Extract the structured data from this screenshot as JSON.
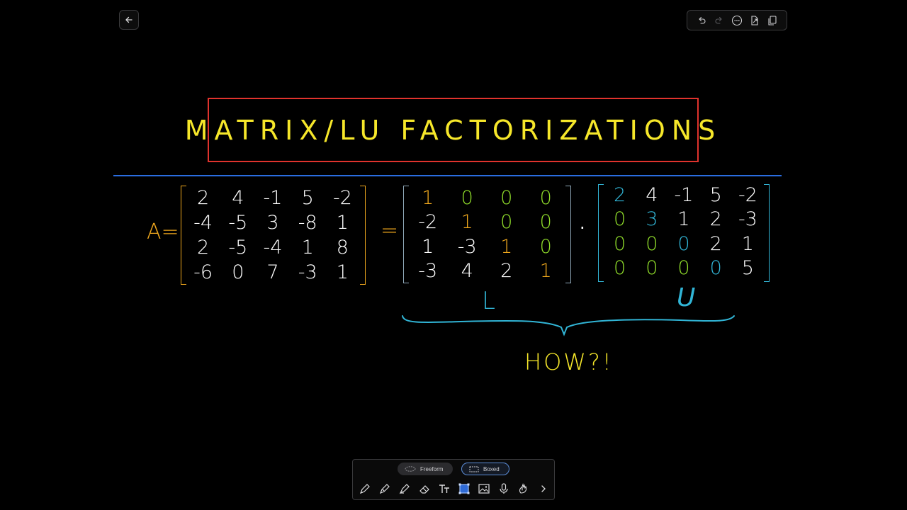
{
  "title": "MATRIX/LU FACTORIZATIONS",
  "a_label": "A=",
  "equals": "=",
  "dot": "·",
  "label_L": "L",
  "label_U": "U",
  "how": "HOW?!",
  "palette": {
    "freeform_label": "Freeform",
    "boxed_label": "Boxed"
  },
  "matrix_A": [
    [
      "2",
      "4",
      "-1",
      "5",
      "-2"
    ],
    [
      "-4",
      "-5",
      "3",
      "-8",
      "1"
    ],
    [
      "2",
      "-5",
      "-4",
      "1",
      "8"
    ],
    [
      "-6",
      "0",
      "7",
      "-3",
      "1"
    ]
  ],
  "matrix_L": [
    [
      "1",
      "0",
      "0",
      "0"
    ],
    [
      "-2",
      "1",
      "0",
      "0"
    ],
    [
      "1",
      "-3",
      "1",
      "0"
    ],
    [
      "-3",
      "4",
      "2",
      "1"
    ]
  ],
  "matrix_U": [
    [
      "2",
      "4",
      "-1",
      "5",
      "-2"
    ],
    [
      "0",
      "3",
      "1",
      "2",
      "-3"
    ],
    [
      "0",
      "0",
      "0",
      "2",
      "1"
    ],
    [
      "0",
      "0",
      "0",
      "0",
      "5"
    ]
  ],
  "colors": {
    "background": "#000000",
    "title_ink": "#f6e72a",
    "title_box": "#e0332d",
    "divider": "#2a6de0",
    "orange": "#f0a81d",
    "green": "#8fdc2a",
    "cyan": "#31b5d6",
    "white": "#ffffff"
  }
}
